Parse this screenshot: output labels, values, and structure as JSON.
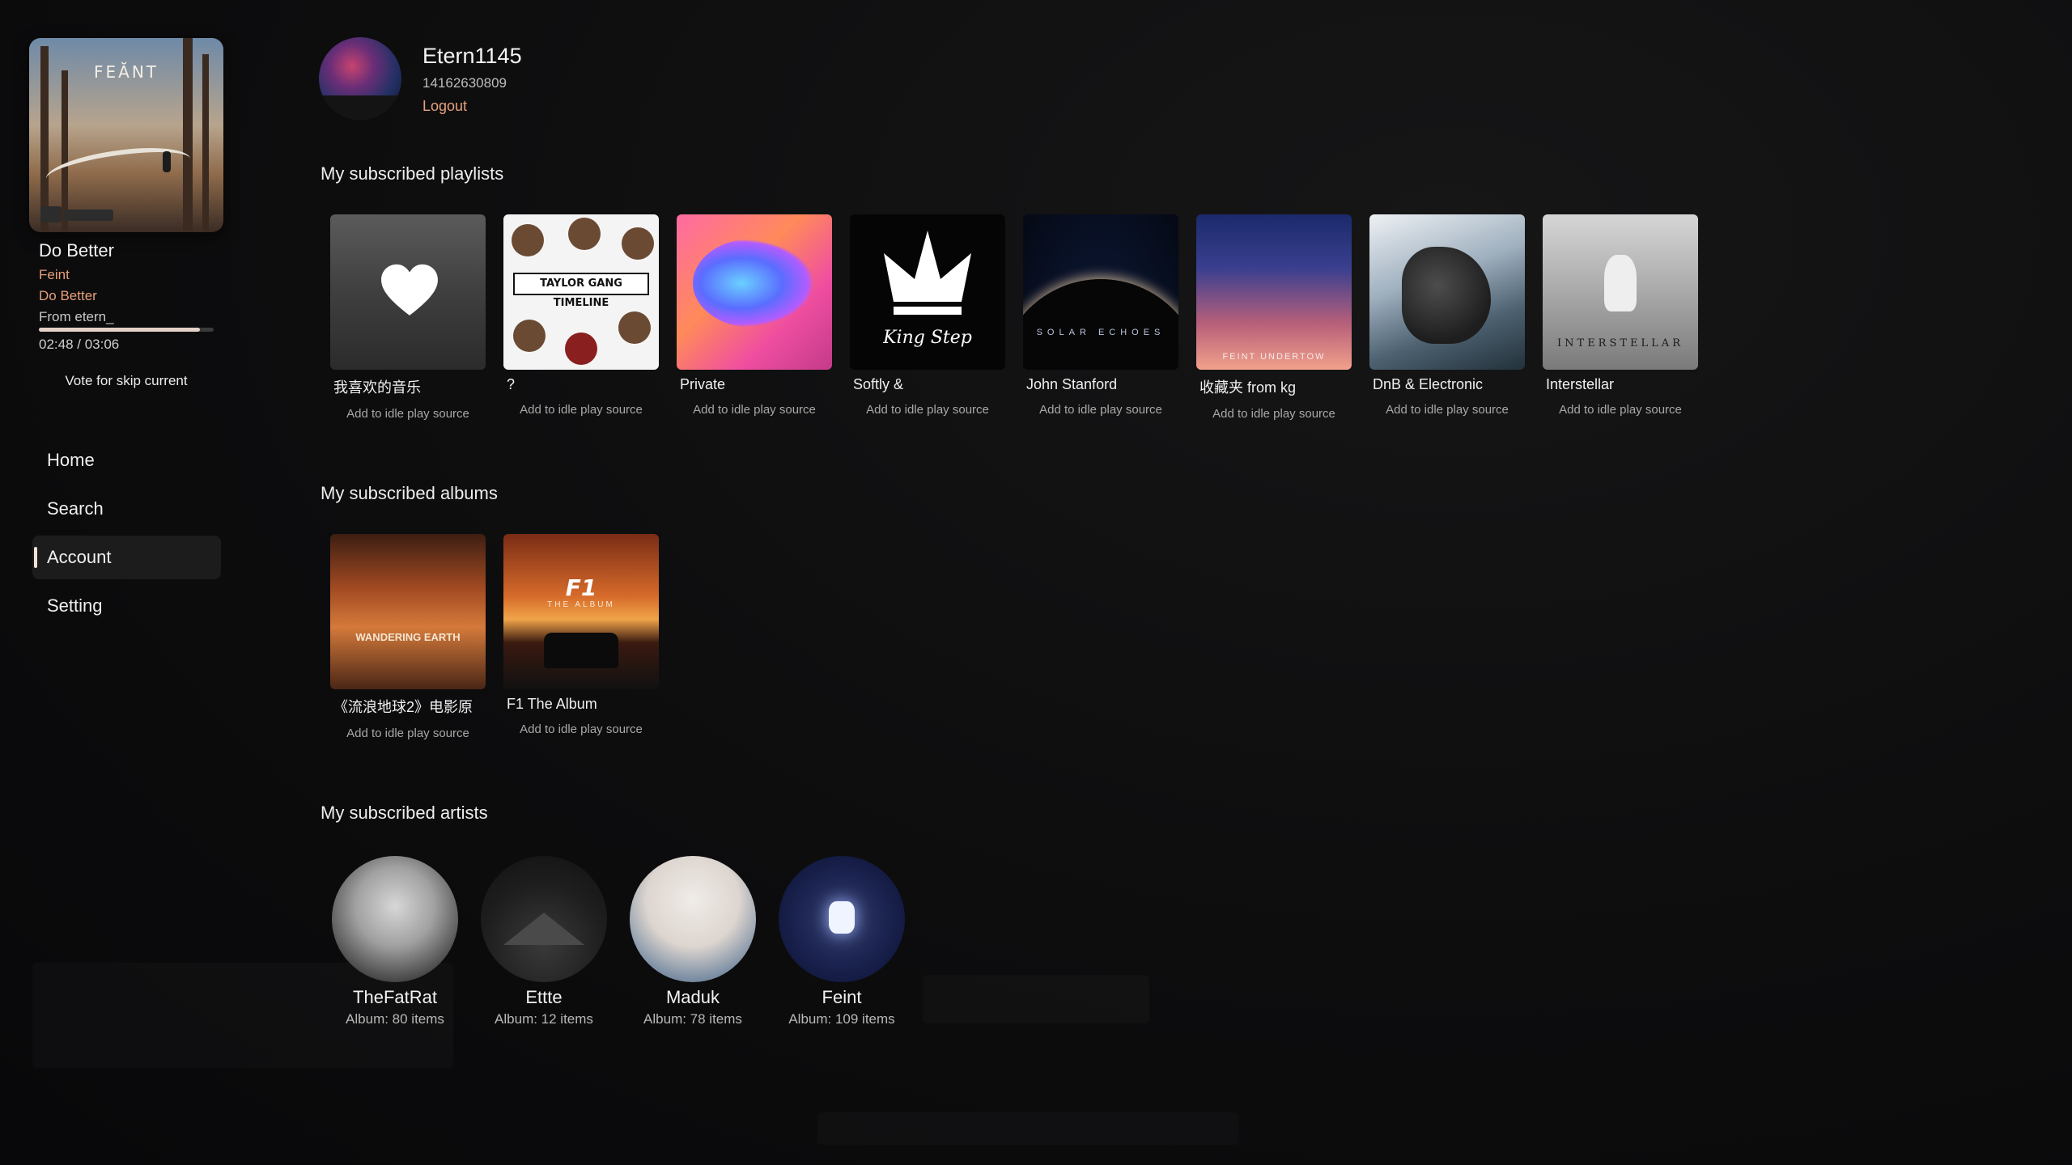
{
  "now_playing": {
    "title": "Do Better",
    "artist": "Feint",
    "album": "Do Better",
    "from": "From etern_",
    "time": "02:48 / 03:06",
    "progress": 0.92,
    "cover_logo": "FEĂNT",
    "vote_label": "Vote for skip current"
  },
  "nav": {
    "items": [
      {
        "label": "Home"
      },
      {
        "label": "Search"
      },
      {
        "label": "Account"
      },
      {
        "label": "Setting"
      }
    ],
    "active": "Account"
  },
  "profile": {
    "username": "Etern1145",
    "user_id": "14162630809",
    "logout_label": "Logout"
  },
  "sections": {
    "playlists_title": "My subscribed playlists",
    "albums_title": "My subscribed albums",
    "artists_title": "My subscribed artists"
  },
  "add_label": "Add to idle play source",
  "playlists": [
    {
      "name": "我喜欢的音乐",
      "art": "heart-cover"
    },
    {
      "name": "?",
      "art": "taylor-gang-cover"
    },
    {
      "name": "Private",
      "art": "private-cover"
    },
    {
      "name": "Softly &",
      "art": "kingstep-cover"
    },
    {
      "name": "John Stanford",
      "art": "solar-echoes-cover"
    },
    {
      "name": "收藏夹 from kg",
      "art": "undertow-cover"
    },
    {
      "name": "DnB & Electronic",
      "art": "dnb-cover"
    },
    {
      "name": "Interstellar",
      "art": "interstellar-cover"
    }
  ],
  "cover_text": {
    "taylor": "TAYLOR GANG TIMELINE",
    "solar": "SOLAR ECHOES",
    "undertow": "FEINT UNDERTOW",
    "interstellar": "INTERSTELLAR",
    "kingstep": "King Step",
    "wandering": "WANDERING EARTH",
    "f1_logo": "F1",
    "f1_sub": "THE ALBUM"
  },
  "albums": [
    {
      "name": "《流浪地球2》电影原",
      "art": "wandering-earth-cover"
    },
    {
      "name": "F1 The Album",
      "art": "f1-cover"
    }
  ],
  "artists": [
    {
      "name": "TheFatRat",
      "count": "Album: 80 items"
    },
    {
      "name": "Ettte",
      "count": "Album: 12 items"
    },
    {
      "name": "Maduk",
      "count": "Album: 78 items"
    },
    {
      "name": "Feint",
      "count": "Album: 109 items"
    }
  ],
  "colors": {
    "accent": "#e8a07a",
    "background": "#0d0d0e",
    "active_nav": "#1c1c1d"
  }
}
